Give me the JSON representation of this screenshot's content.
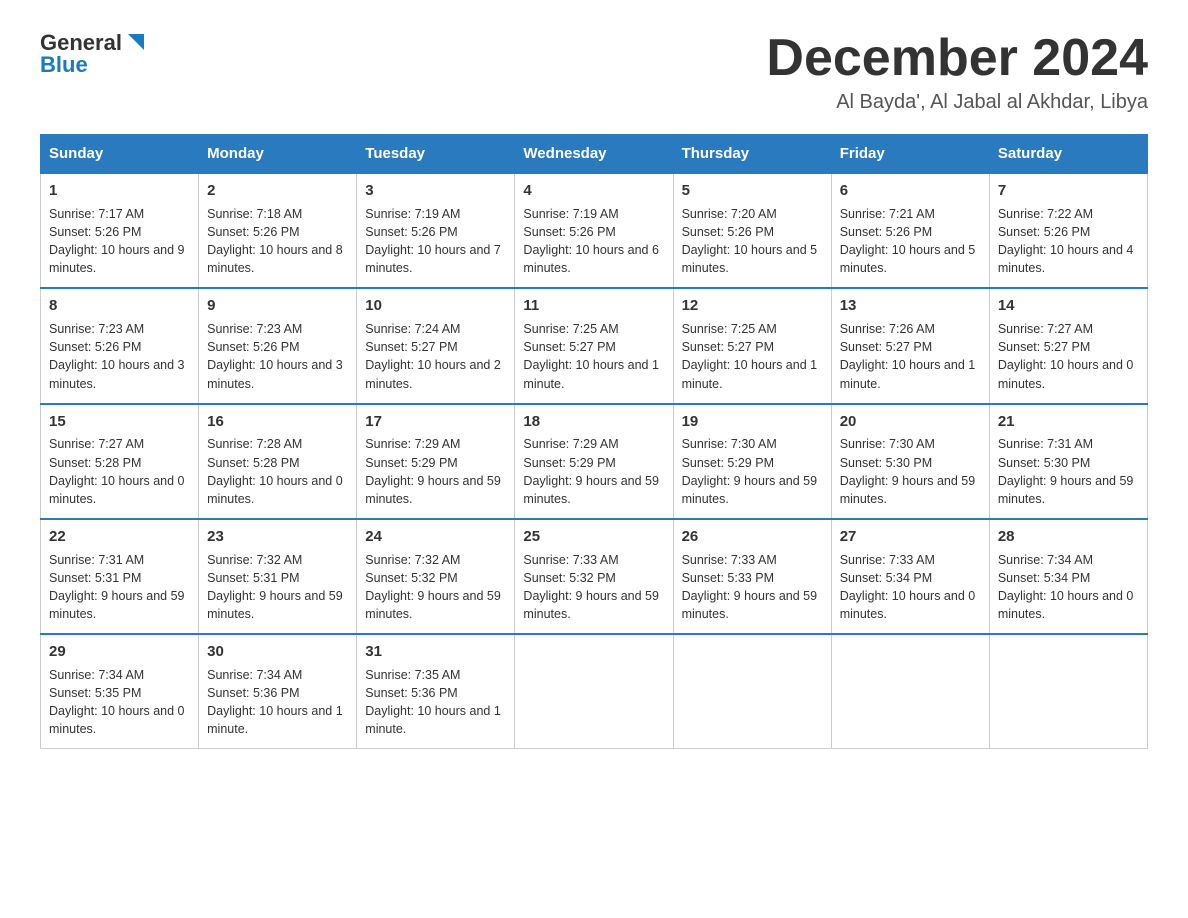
{
  "header": {
    "logo_general": "General",
    "logo_blue": "Blue",
    "month_title": "December 2024",
    "location": "Al Bayda', Al Jabal al Akhdar, Libya"
  },
  "days_of_week": [
    "Sunday",
    "Monday",
    "Tuesday",
    "Wednesday",
    "Thursday",
    "Friday",
    "Saturday"
  ],
  "weeks": [
    [
      {
        "day": "1",
        "sunrise": "7:17 AM",
        "sunset": "5:26 PM",
        "daylight": "10 hours and 9 minutes."
      },
      {
        "day": "2",
        "sunrise": "7:18 AM",
        "sunset": "5:26 PM",
        "daylight": "10 hours and 8 minutes."
      },
      {
        "day": "3",
        "sunrise": "7:19 AM",
        "sunset": "5:26 PM",
        "daylight": "10 hours and 7 minutes."
      },
      {
        "day": "4",
        "sunrise": "7:19 AM",
        "sunset": "5:26 PM",
        "daylight": "10 hours and 6 minutes."
      },
      {
        "day": "5",
        "sunrise": "7:20 AM",
        "sunset": "5:26 PM",
        "daylight": "10 hours and 5 minutes."
      },
      {
        "day": "6",
        "sunrise": "7:21 AM",
        "sunset": "5:26 PM",
        "daylight": "10 hours and 5 minutes."
      },
      {
        "day": "7",
        "sunrise": "7:22 AM",
        "sunset": "5:26 PM",
        "daylight": "10 hours and 4 minutes."
      }
    ],
    [
      {
        "day": "8",
        "sunrise": "7:23 AM",
        "sunset": "5:26 PM",
        "daylight": "10 hours and 3 minutes."
      },
      {
        "day": "9",
        "sunrise": "7:23 AM",
        "sunset": "5:26 PM",
        "daylight": "10 hours and 3 minutes."
      },
      {
        "day": "10",
        "sunrise": "7:24 AM",
        "sunset": "5:27 PM",
        "daylight": "10 hours and 2 minutes."
      },
      {
        "day": "11",
        "sunrise": "7:25 AM",
        "sunset": "5:27 PM",
        "daylight": "10 hours and 1 minute."
      },
      {
        "day": "12",
        "sunrise": "7:25 AM",
        "sunset": "5:27 PM",
        "daylight": "10 hours and 1 minute."
      },
      {
        "day": "13",
        "sunrise": "7:26 AM",
        "sunset": "5:27 PM",
        "daylight": "10 hours and 1 minute."
      },
      {
        "day": "14",
        "sunrise": "7:27 AM",
        "sunset": "5:27 PM",
        "daylight": "10 hours and 0 minutes."
      }
    ],
    [
      {
        "day": "15",
        "sunrise": "7:27 AM",
        "sunset": "5:28 PM",
        "daylight": "10 hours and 0 minutes."
      },
      {
        "day": "16",
        "sunrise": "7:28 AM",
        "sunset": "5:28 PM",
        "daylight": "10 hours and 0 minutes."
      },
      {
        "day": "17",
        "sunrise": "7:29 AM",
        "sunset": "5:29 PM",
        "daylight": "9 hours and 59 minutes."
      },
      {
        "day": "18",
        "sunrise": "7:29 AM",
        "sunset": "5:29 PM",
        "daylight": "9 hours and 59 minutes."
      },
      {
        "day": "19",
        "sunrise": "7:30 AM",
        "sunset": "5:29 PM",
        "daylight": "9 hours and 59 minutes."
      },
      {
        "day": "20",
        "sunrise": "7:30 AM",
        "sunset": "5:30 PM",
        "daylight": "9 hours and 59 minutes."
      },
      {
        "day": "21",
        "sunrise": "7:31 AM",
        "sunset": "5:30 PM",
        "daylight": "9 hours and 59 minutes."
      }
    ],
    [
      {
        "day": "22",
        "sunrise": "7:31 AM",
        "sunset": "5:31 PM",
        "daylight": "9 hours and 59 minutes."
      },
      {
        "day": "23",
        "sunrise": "7:32 AM",
        "sunset": "5:31 PM",
        "daylight": "9 hours and 59 minutes."
      },
      {
        "day": "24",
        "sunrise": "7:32 AM",
        "sunset": "5:32 PM",
        "daylight": "9 hours and 59 minutes."
      },
      {
        "day": "25",
        "sunrise": "7:33 AM",
        "sunset": "5:32 PM",
        "daylight": "9 hours and 59 minutes."
      },
      {
        "day": "26",
        "sunrise": "7:33 AM",
        "sunset": "5:33 PM",
        "daylight": "9 hours and 59 minutes."
      },
      {
        "day": "27",
        "sunrise": "7:33 AM",
        "sunset": "5:34 PM",
        "daylight": "10 hours and 0 minutes."
      },
      {
        "day": "28",
        "sunrise": "7:34 AM",
        "sunset": "5:34 PM",
        "daylight": "10 hours and 0 minutes."
      }
    ],
    [
      {
        "day": "29",
        "sunrise": "7:34 AM",
        "sunset": "5:35 PM",
        "daylight": "10 hours and 0 minutes."
      },
      {
        "day": "30",
        "sunrise": "7:34 AM",
        "sunset": "5:36 PM",
        "daylight": "10 hours and 1 minute."
      },
      {
        "day": "31",
        "sunrise": "7:35 AM",
        "sunset": "5:36 PM",
        "daylight": "10 hours and 1 minute."
      },
      null,
      null,
      null,
      null
    ]
  ]
}
